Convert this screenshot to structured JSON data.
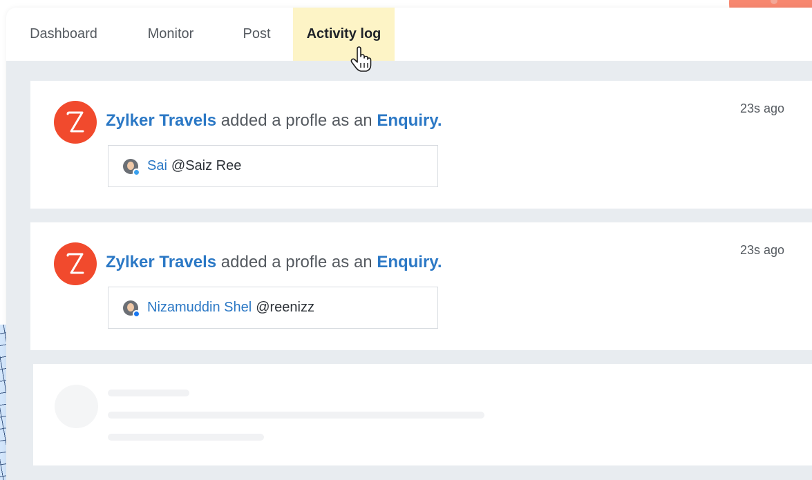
{
  "tabs": [
    {
      "label": "Dashboard",
      "active": false
    },
    {
      "label": "Monitor",
      "active": false
    },
    {
      "label": "Post",
      "active": false
    },
    {
      "label": "Activity log",
      "active": true
    }
  ],
  "activity": [
    {
      "actor": "Zylker Travels",
      "action": "added a profle as an",
      "target": "Enquiry.",
      "time": "23s ago",
      "profile": {
        "name": "Sai",
        "handle": "@Saiz Ree",
        "network": "twitter-icon"
      }
    },
    {
      "actor": "Zylker Travels",
      "action": "added a profle as an",
      "target": "Enquiry.",
      "time": "23s ago",
      "profile": {
        "name": "Nizamuddin Shel",
        "handle": "@reenizz",
        "network": "facebook-icon"
      }
    }
  ],
  "colors": {
    "brand_logo": "#f14a2d",
    "link": "#2b78c5",
    "active_tab": "#fdf4c6",
    "panel_bg": "#e8ecf0"
  }
}
